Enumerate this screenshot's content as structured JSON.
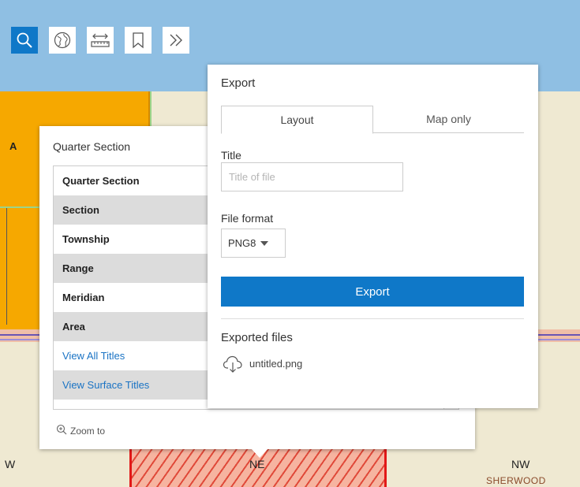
{
  "map": {
    "labels": {
      "w": "W",
      "a": "A",
      "ne": "NE",
      "nw": "NW",
      "sherwood": "SHERWOOD"
    },
    "colors": {
      "parcel_orange": "#f6a800",
      "parcel_selected_outline": "#e21818",
      "sky": "#8fbfe3",
      "land": "#efe9d2"
    }
  },
  "toolbar": {
    "buttons": [
      {
        "icon": "search-icon",
        "active": true
      },
      {
        "icon": "basemap-globe-icon",
        "active": false
      },
      {
        "icon": "measure-icon",
        "active": false
      },
      {
        "icon": "bookmark-icon",
        "active": false
      },
      {
        "icon": "expand-chevrons-icon",
        "active": false
      }
    ],
    "accent": "#0f78c8"
  },
  "popup": {
    "title": "Quarter Section",
    "rows": [
      {
        "label": "Quarter Section"
      },
      {
        "label": "Section"
      },
      {
        "label": "Township"
      },
      {
        "label": "Range"
      },
      {
        "label": "Meridian"
      },
      {
        "label": "Area"
      },
      {
        "label": "View All Titles"
      },
      {
        "label": "View Surface Titles"
      }
    ],
    "zoom_to": "Zoom to"
  },
  "export": {
    "title": "Export",
    "tabs": [
      "Layout",
      "Map only"
    ],
    "active_tab": "Layout",
    "title_label": "Title",
    "title_placeholder": "Title of file",
    "title_value": "",
    "format_label": "File format",
    "format_value": "PNG8",
    "export_button": "Export",
    "exported_heading": "Exported files",
    "exported_files": [
      "untitled.png"
    ]
  }
}
